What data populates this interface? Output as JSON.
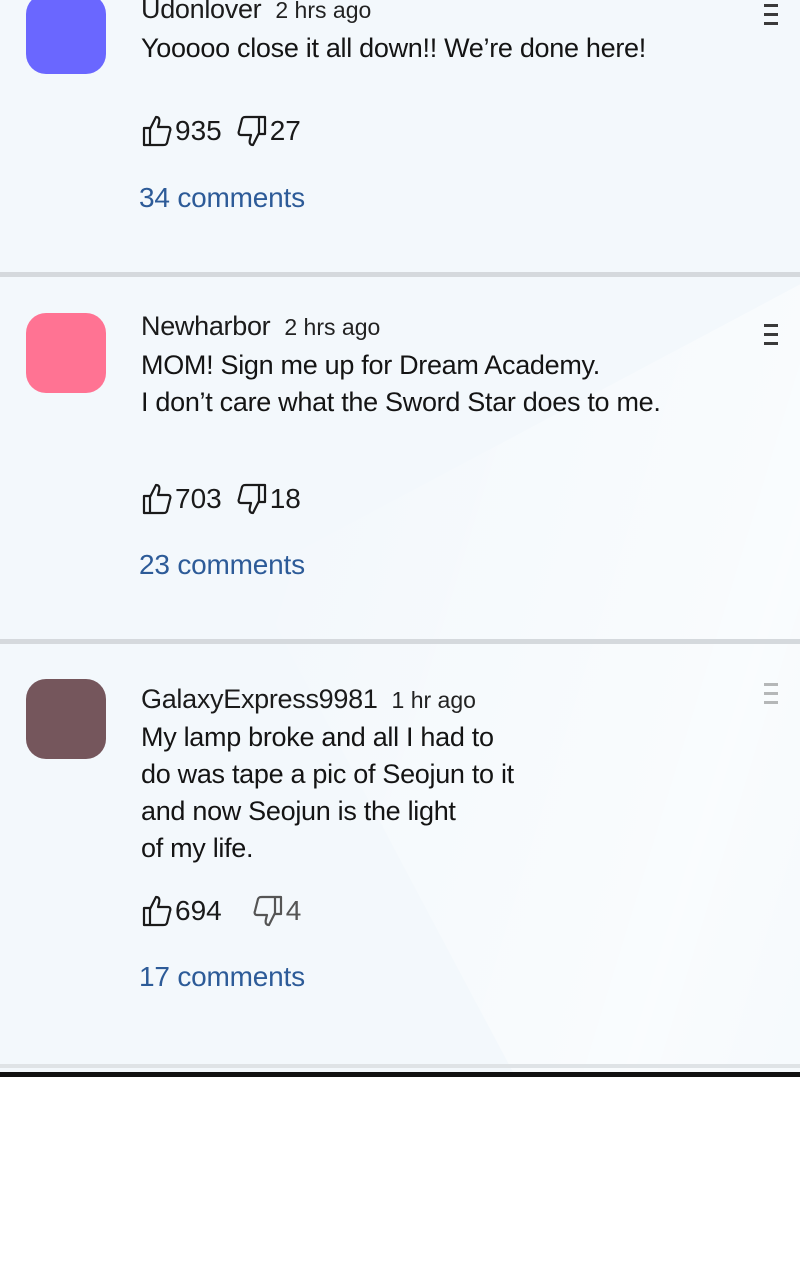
{
  "comments": [
    {
      "author": "Udonlover",
      "time": "2 hrs ago",
      "text": "Yooooo close it all down!! We’re done here!",
      "likes": "935",
      "dislikes": "27",
      "comments_label": "34 comments",
      "avatar_color": "#6a67ff"
    },
    {
      "author": "Newharbor",
      "time": "2 hrs ago",
      "text": "MOM! Sign me up for Dream Academy.\nI don’t care what the Sword Star does to me.",
      "likes": "703",
      "dislikes": "18",
      "comments_label": "23 comments",
      "avatar_color": "#ff7393"
    },
    {
      "author": "GalaxyExpress9981",
      "time": "1 hr ago",
      "text": "My lamp broke and all I had to\ndo was tape a pic of Seojun to it\nand now Seojun is the light\nof my life.",
      "likes": "694",
      "dislikes": "4",
      "comments_label": "17 comments",
      "avatar_color": "#75565c"
    }
  ],
  "icons": {
    "like": "thumbs-up-icon",
    "dislike": "thumbs-down-icon",
    "more": "more-menu-icon"
  }
}
